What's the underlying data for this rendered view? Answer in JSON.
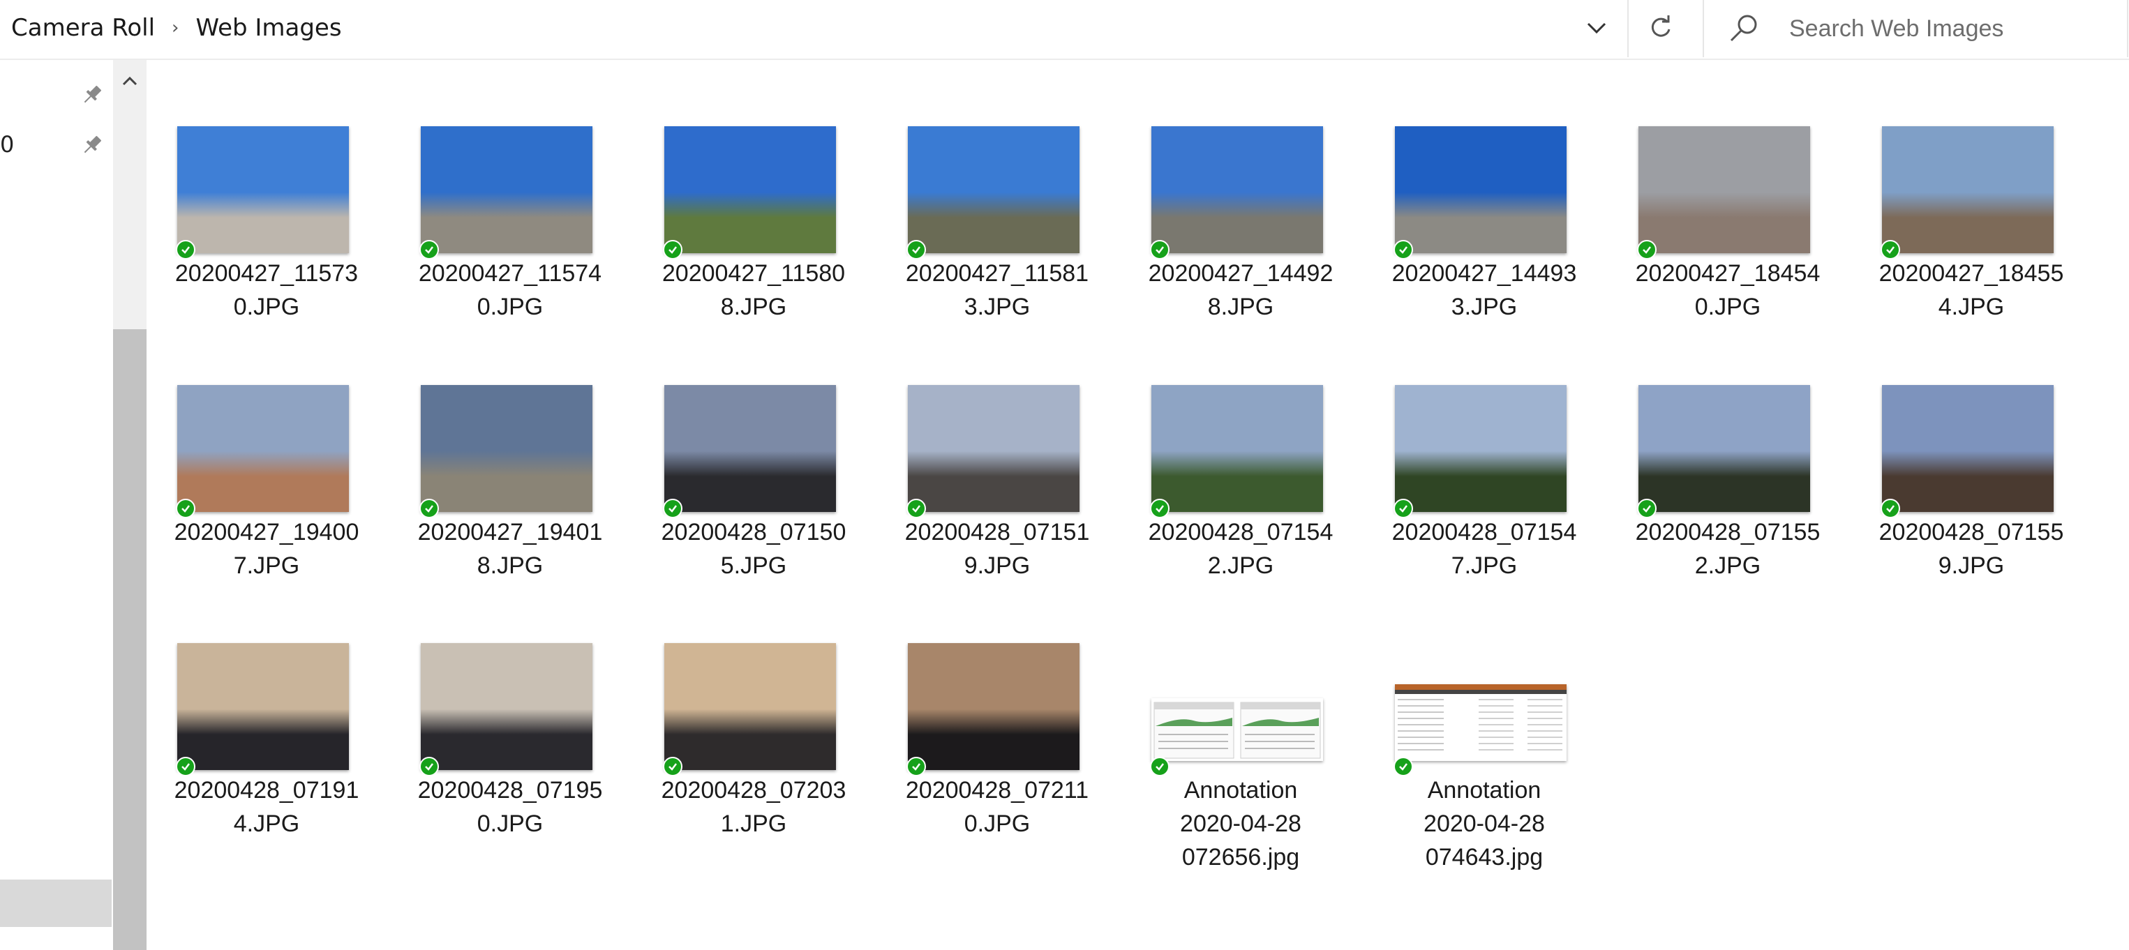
{
  "breadcrumb": {
    "items": [
      "Camera Roll",
      "Web Images"
    ],
    "separator": "›"
  },
  "search": {
    "placeholder": "Search Web Images",
    "value": ""
  },
  "nav": {
    "items": [
      {
        "label": ""
      },
      {
        "label": "0"
      }
    ]
  },
  "status_colors": {
    "synced": "#16a11a"
  },
  "files": [
    {
      "name_line1": "20200427_11573",
      "name_line2": "0.JPG",
      "name_line3": "",
      "kind": "photo",
      "sky": "#3f7fd6",
      "ground": "#bdb6ad"
    },
    {
      "name_line1": "20200427_11574",
      "name_line2": "0.JPG",
      "name_line3": "",
      "kind": "photo",
      "sky": "#2f6fcb",
      "ground": "#8f8a80"
    },
    {
      "name_line1": "20200427_11580",
      "name_line2": "8.JPG",
      "name_line3": "",
      "kind": "photo",
      "sky": "#2e6ccc",
      "ground": "#5f7a3e"
    },
    {
      "name_line1": "20200427_11581",
      "name_line2": "3.JPG",
      "name_line3": "",
      "kind": "photo",
      "sky": "#3a7bd3",
      "ground": "#6a6b55"
    },
    {
      "name_line1": "20200427_14492",
      "name_line2": "8.JPG",
      "name_line3": "",
      "kind": "photo",
      "sky": "#3a76cf",
      "ground": "#7a786f"
    },
    {
      "name_line1": "20200427_14493",
      "name_line2": "3.JPG",
      "name_line3": "",
      "kind": "photo",
      "sky": "#1f5fc2",
      "ground": "#8c8a84"
    },
    {
      "name_line1": "20200427_18454",
      "name_line2": "0.JPG",
      "name_line3": "",
      "kind": "photo",
      "sky": "#9c9ea3",
      "ground": "#8a7a70"
    },
    {
      "name_line1": "20200427_18455",
      "name_line2": "4.JPG",
      "name_line3": "",
      "kind": "photo",
      "sky": "#7f9fc7",
      "ground": "#7d6a58"
    },
    {
      "name_line1": "20200427_19400",
      "name_line2": "7.JPG",
      "name_line3": "",
      "kind": "photo",
      "sky": "#8fa3c2",
      "ground": "#b07a5a"
    },
    {
      "name_line1": "20200427_19401",
      "name_line2": "8.JPG",
      "name_line3": "",
      "kind": "photo",
      "sky": "#5f7596",
      "ground": "#8a8476"
    },
    {
      "name_line1": "20200428_07150",
      "name_line2": "5.JPG",
      "name_line3": "",
      "kind": "photo",
      "sky": "#7c8aa6",
      "ground": "#2a2a2e"
    },
    {
      "name_line1": "20200428_07151",
      "name_line2": "9.JPG",
      "name_line3": "",
      "kind": "photo",
      "sky": "#a6b2c8",
      "ground": "#4a4644"
    },
    {
      "name_line1": "20200428_07154",
      "name_line2": "2.JPG",
      "name_line3": "",
      "kind": "photo",
      "sky": "#8ea4c4",
      "ground": "#3c5a2e"
    },
    {
      "name_line1": "20200428_07154",
      "name_line2": "7.JPG",
      "name_line3": "",
      "kind": "photo",
      "sky": "#9fb3d0",
      "ground": "#2f4524"
    },
    {
      "name_line1": "20200428_07155",
      "name_line2": "2.JPG",
      "name_line3": "",
      "kind": "photo",
      "sky": "#8ea3c6",
      "ground": "#2c3426"
    },
    {
      "name_line1": "20200428_07155",
      "name_line2": "9.JPG",
      "name_line3": "",
      "kind": "photo",
      "sky": "#7d93bd",
      "ground": "#4a3a30"
    },
    {
      "name_line1": "20200428_07191",
      "name_line2": "4.JPG",
      "name_line3": "",
      "kind": "photo",
      "sky": "#c9b49a",
      "ground": "#26252a"
    },
    {
      "name_line1": "20200428_07195",
      "name_line2": "0.JPG",
      "name_line3": "",
      "kind": "photo",
      "sky": "#c9c0b4",
      "ground": "#2a292e"
    },
    {
      "name_line1": "20200428_07203",
      "name_line2": "1.JPG",
      "name_line3": "",
      "kind": "photo",
      "sky": "#d0b594",
      "ground": "#2e2b2c"
    },
    {
      "name_line1": "20200428_07211",
      "name_line2": "0.JPG",
      "name_line3": "",
      "kind": "photo",
      "sky": "#a8866a",
      "ground": "#1c1a1c"
    },
    {
      "name_line1": "Annotation",
      "name_line2": "2020-04-28",
      "name_line3": "072656.jpg",
      "kind": "doc-green",
      "sky": "#ffffff",
      "ground": "#ffffff"
    },
    {
      "name_line1": "Annotation",
      "name_line2": "2020-04-28",
      "name_line3": "074643.jpg",
      "kind": "doc-table",
      "sky": "#ffffff",
      "ground": "#ffffff"
    }
  ]
}
